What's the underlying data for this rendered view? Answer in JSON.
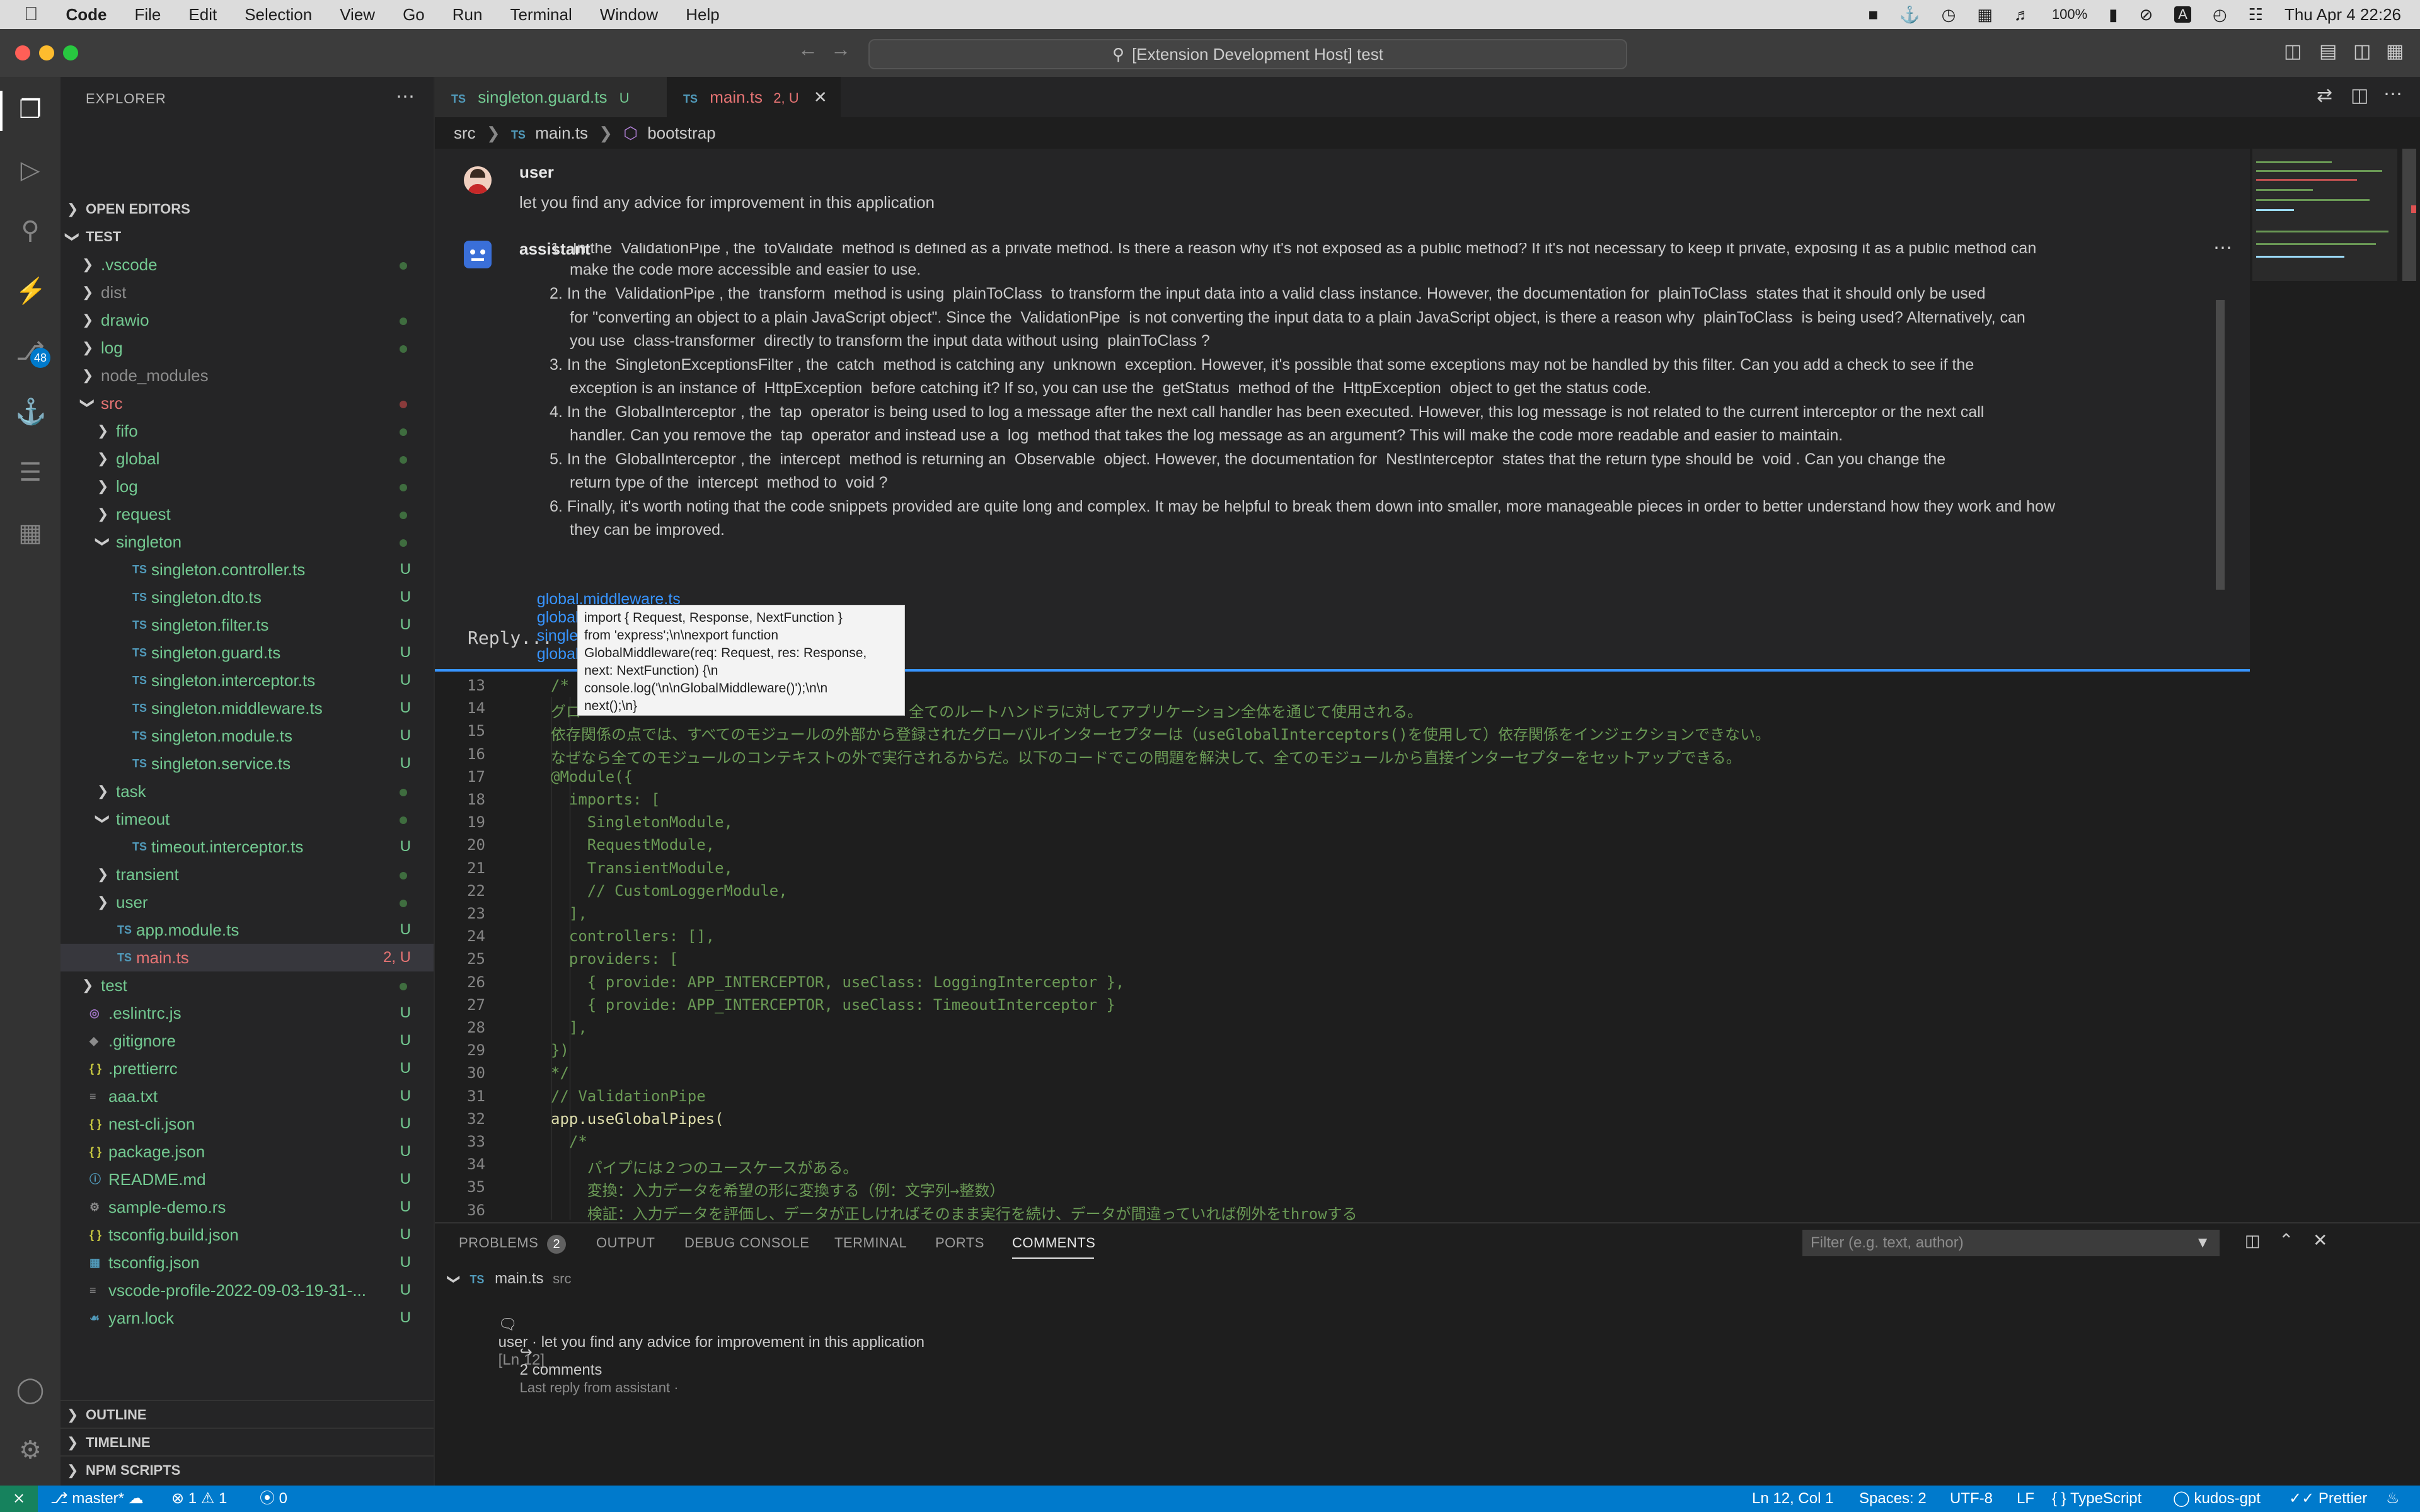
{
  "menubar": {
    "app": "Code",
    "items": [
      "File",
      "Edit",
      "Selection",
      "View",
      "Go",
      "Run",
      "Terminal",
      "Window",
      "Help"
    ],
    "battery": "100%",
    "input_source": "A",
    "clock": "Thu Apr 4  22:26"
  },
  "titlebar": {
    "search": "[Extension Development Host] test"
  },
  "activity": {
    "scm_badge": "48"
  },
  "sidebar": {
    "title": "EXPLORER",
    "open_editors": "OPEN EDITORS",
    "root": "TEST",
    "tree": [
      {
        "label": ".vscode",
        "kind": "folder",
        "depth": 0,
        "status": "dot",
        "color": "green"
      },
      {
        "label": "dist",
        "kind": "folder",
        "depth": 0,
        "status": "",
        "color": "grey"
      },
      {
        "label": "drawio",
        "kind": "folder",
        "depth": 0,
        "status": "dot",
        "color": "green"
      },
      {
        "label": "log",
        "kind": "folder",
        "depth": 0,
        "status": "dot",
        "color": "green"
      },
      {
        "label": "node_modules",
        "kind": "folder",
        "depth": 0,
        "status": "",
        "color": "grey"
      },
      {
        "label": "src",
        "kind": "folder-open",
        "depth": 0,
        "status": "reddot",
        "color": "red"
      },
      {
        "label": "fifo",
        "kind": "folder",
        "depth": 1,
        "status": "dot",
        "color": "green"
      },
      {
        "label": "global",
        "kind": "folder",
        "depth": 1,
        "status": "dot",
        "color": "green"
      },
      {
        "label": "log",
        "kind": "folder",
        "depth": 1,
        "status": "dot",
        "color": "green"
      },
      {
        "label": "request",
        "kind": "folder",
        "depth": 1,
        "status": "dot",
        "color": "green"
      },
      {
        "label": "singleton",
        "kind": "folder-open",
        "depth": 1,
        "status": "dot",
        "color": "green"
      },
      {
        "label": "singleton.controller.ts",
        "kind": "ts",
        "depth": 2,
        "status": "U",
        "color": "green"
      },
      {
        "label": "singleton.dto.ts",
        "kind": "ts",
        "depth": 2,
        "status": "U",
        "color": "green"
      },
      {
        "label": "singleton.filter.ts",
        "kind": "ts",
        "depth": 2,
        "status": "U",
        "color": "green"
      },
      {
        "label": "singleton.guard.ts",
        "kind": "ts",
        "depth": 2,
        "status": "U",
        "color": "green"
      },
      {
        "label": "singleton.interceptor.ts",
        "kind": "ts",
        "depth": 2,
        "status": "U",
        "color": "green"
      },
      {
        "label": "singleton.middleware.ts",
        "kind": "ts",
        "depth": 2,
        "status": "U",
        "color": "green"
      },
      {
        "label": "singleton.module.ts",
        "kind": "ts",
        "depth": 2,
        "status": "U",
        "color": "green"
      },
      {
        "label": "singleton.service.ts",
        "kind": "ts",
        "depth": 2,
        "status": "U",
        "color": "green"
      },
      {
        "label": "task",
        "kind": "folder",
        "depth": 1,
        "status": "dot",
        "color": "green"
      },
      {
        "label": "timeout",
        "kind": "folder-open",
        "depth": 1,
        "status": "dot",
        "color": "green"
      },
      {
        "label": "timeout.interceptor.ts",
        "kind": "ts",
        "depth": 2,
        "status": "U",
        "color": "green"
      },
      {
        "label": "transient",
        "kind": "folder",
        "depth": 1,
        "status": "dot",
        "color": "green"
      },
      {
        "label": "user",
        "kind": "folder",
        "depth": 1,
        "status": "dot",
        "color": "green"
      },
      {
        "label": "app.module.ts",
        "kind": "ts",
        "depth": 1,
        "status": "U",
        "color": "green"
      },
      {
        "label": "main.ts",
        "kind": "ts",
        "depth": 1,
        "status": "2, U",
        "color": "red",
        "selected": true
      },
      {
        "label": "test",
        "kind": "folder",
        "depth": 0,
        "status": "dot",
        "color": "green"
      },
      {
        "label": ".eslintrc.js",
        "kind": "eslint",
        "depth": 0,
        "status": "U",
        "color": "green"
      },
      {
        "label": ".gitignore",
        "kind": "git",
        "depth": 0,
        "status": "U",
        "color": "green"
      },
      {
        "label": ".prettierrc",
        "kind": "json",
        "depth": 0,
        "status": "U",
        "color": "green"
      },
      {
        "label": "aaa.txt",
        "kind": "txt",
        "depth": 0,
        "status": "U",
        "color": "green"
      },
      {
        "label": "nest-cli.json",
        "kind": "json",
        "depth": 0,
        "status": "U",
        "color": "green"
      },
      {
        "label": "package.json",
        "kind": "json",
        "depth": 0,
        "status": "U",
        "color": "green"
      },
      {
        "label": "README.md",
        "kind": "info",
        "depth": 0,
        "status": "U",
        "color": "green"
      },
      {
        "label": "sample-demo.rs",
        "kind": "rust",
        "depth": 0,
        "status": "U",
        "color": "green"
      },
      {
        "label": "tsconfig.build.json",
        "kind": "json",
        "depth": 0,
        "status": "U",
        "color": "green"
      },
      {
        "label": "tsconfig.json",
        "kind": "tsconfig",
        "depth": 0,
        "status": "U",
        "color": "green"
      },
      {
        "label": "vscode-profile-2022-09-03-19-31-...",
        "kind": "file",
        "depth": 0,
        "status": "U",
        "color": "green"
      },
      {
        "label": "yarn.lock",
        "kind": "yarn",
        "depth": 0,
        "status": "U",
        "color": "green"
      }
    ],
    "outline": "OUTLINE",
    "timeline": "TIMELINE",
    "npm_scripts": "NPM SCRIPTS"
  },
  "tabs": [
    {
      "name": "singleton.guard.ts",
      "status": "U",
      "active": false
    },
    {
      "name": "main.ts",
      "status": "2, U",
      "active": true
    }
  ],
  "breadcrumb": {
    "folder": "src",
    "file": "main.ts",
    "symbol": "bootstrap"
  },
  "thread": {
    "user_name": "user",
    "user_text": "let you find any advice for improvement in this application",
    "assistant_name": "assistant",
    "answer_cut": "In the  ValidationPipe , the  toValidate  method is defined as a private method. Is there a reason why it's not exposed as a public method? If it's not necessary to keep it private, exposing it as a public method can",
    "answer_cut2": "make the code more accessible and easier to use.",
    "items": [
      {
        "n": "2.",
        "line1": "In the  ValidationPipe , the  transform  method is using  plainToClass  to transform the input data into a valid class instance. However, the documentation for  plainToClass  states that it should only be used",
        "line2": "for \"converting an object to a plain JavaScript object\". Since the  ValidationPipe  is not converting the input data to a plain JavaScript object, is there a reason why  plainToClass  is being used? Alternatively, can",
        "line3": "you use  class-transformer  directly to transform the input data without using  plainToClass ?"
      },
      {
        "n": "3.",
        "line1": "In the  SingletonExceptionsFilter , the  catch  method is catching any  unknown  exception. However, it's possible that some exceptions may not be handled by this filter. Can you add a check to see if the",
        "line2": "exception is an instance of  HttpException  before catching it? If so, you can use the  getStatus  method of the  HttpException  object to get the status code.",
        "line3": ""
      },
      {
        "n": "4.",
        "line1": "In the  GlobalInterceptor , the  tap  operator is being used to log a message after the next call handler has been executed. However, this log message is not related to the current interceptor or the next call",
        "line2": "handler. Can you remove the  tap  operator and instead use a  log  method that takes the log message as an argument? This will make the code more readable and easier to maintain.",
        "line3": ""
      },
      {
        "n": "5.",
        "line1": "In the  GlobalInterceptor , the  intercept  method is returning an  Observable  object. However, the documentation for  NestInterceptor  states that the return type should be  void . Can you change the",
        "line2": "return type of the  intercept  method to  void ?",
        "line3": ""
      },
      {
        "n": "6.",
        "line1": "Finally, it's worth noting that the code snippets provided are quite long and complex. It may be helpful to break them down into smaller, more manageable pieces in order to better understand how they work and how",
        "line2": "they can be improved.",
        "line3": ""
      }
    ],
    "links": [
      "global.middleware.ts",
      "global.pipe.ts",
      "singleton.filter.ts",
      "global.inspector.ts"
    ],
    "reply_placeholder": "Reply...",
    "tooltip": [
      "import { Request, Response, NextFunction }",
      "from 'express';\\n\\nexport function",
      "GlobalMiddleware(req: Request, res: Response,",
      "next: NextFunction) {\\n",
      "console.log('\\n\\nGlobalMiddleware()');\\n\\n",
      "next();\\n}"
    ]
  },
  "code": [
    {
      "n": "13",
      "text": "/*",
      "color": "#6a9955",
      "indent": 0
    },
    {
      "n": "14",
      "text": "グロ                                    全てのルートハンドラに対してアプリケーション全体を通じて使用される。",
      "color": "#6a9955",
      "indent": 0
    },
    {
      "n": "15",
      "text": "依存関係の点では、すべてのモジュールの外部から登録されたグローバルインターセプターは（useGlobalInterceptors()を使用して）依存関係をインジェクションできない。",
      "color": "#6a9955",
      "indent": 0
    },
    {
      "n": "16",
      "text": "なぜなら全てのモジュールのコンテキストの外で実行されるからだ。以下のコードでこの問題を解決して、全てのモジュールから直接インターセプターをセットアップできる。",
      "color": "#6a9955",
      "indent": 0
    },
    {
      "n": "17",
      "text": "@Module({",
      "color": "#6a9955",
      "indent": 0
    },
    {
      "n": "18",
      "text": "  imports: [",
      "color": "#6a9955",
      "indent": 0
    },
    {
      "n": "19",
      "text": "    SingletonModule,",
      "color": "#6a9955",
      "indent": 0
    },
    {
      "n": "20",
      "text": "    RequestModule,",
      "color": "#6a9955",
      "indent": 0
    },
    {
      "n": "21",
      "text": "    TransientModule,",
      "color": "#6a9955",
      "indent": 0
    },
    {
      "n": "22",
      "text": "    // CustomLoggerModule,",
      "color": "#6a9955",
      "indent": 0
    },
    {
      "n": "23",
      "text": "  ],",
      "color": "#6a9955",
      "indent": 0
    },
    {
      "n": "24",
      "text": "  controllers: [],",
      "color": "#6a9955",
      "indent": 0
    },
    {
      "n": "25",
      "text": "  providers: [",
      "color": "#6a9955",
      "indent": 0
    },
    {
      "n": "26",
      "text": "    { provide: APP_INTERCEPTOR, useClass: LoggingInterceptor },",
      "color": "#6a9955",
      "indent": 0
    },
    {
      "n": "27",
      "text": "    { provide: APP_INTERCEPTOR, useClass: TimeoutInterceptor }",
      "color": "#6a9955",
      "indent": 0
    },
    {
      "n": "28",
      "text": "  ],",
      "color": "#6a9955",
      "indent": 0
    },
    {
      "n": "29",
      "text": "})",
      "color": "#6a9955",
      "indent": 0
    },
    {
      "n": "30",
      "text": "*/",
      "color": "#6a9955",
      "indent": 0
    },
    {
      "n": "31",
      "text": "// ValidationPipe",
      "color": "#6a9955",
      "indent": 0
    },
    {
      "n": "32",
      "text": "app.useGlobalPipes(",
      "color": "#dcdcaa",
      "indent": 0
    },
    {
      "n": "33",
      "text": "  /*",
      "color": "#6a9955",
      "indent": 0
    },
    {
      "n": "34",
      "text": "    パイプには２つのユースケースがある。",
      "color": "#6a9955",
      "indent": 0
    },
    {
      "n": "35",
      "text": "    変換：入力データを希望の形に変換する（例：文字列→整数）",
      "color": "#6a9955",
      "indent": 0
    },
    {
      "n": "36",
      "text": "    検証：入力データを評価し、データが正しければそのまま実行を続け、データが間違っていれば例外をthrowする",
      "color": "#6a9955",
      "indent": 0
    }
  ],
  "panel": {
    "tabs": [
      "PROBLEMS",
      "OUTPUT",
      "DEBUG CONSOLE",
      "TERMINAL",
      "PORTS",
      "COMMENTS"
    ],
    "problems_count": "2",
    "active_tab": "COMMENTS",
    "filter_placeholder": "Filter (e.g. text, author)",
    "file": "main.ts",
    "file_dir": "src",
    "comment": "user · let you find any advice for improvement in this application",
    "comment_line": "[Ln 12]",
    "replies": "2 comments",
    "last_reply": "Last reply from assistant ·"
  },
  "status": {
    "branch": "master*",
    "errors": "1",
    "warnings": "1",
    "ports": "0",
    "position": "Ln 12, Col 1",
    "spaces": "Spaces: 2",
    "encoding": "UTF-8",
    "eol": "LF",
    "language": "TypeScript",
    "extension": "kudos-gpt",
    "formatter": "Prettier"
  },
  "colors": {
    "accent": "#007acc",
    "link": "#3794ff",
    "untracked": "#73c991",
    "error": "#e57373"
  }
}
